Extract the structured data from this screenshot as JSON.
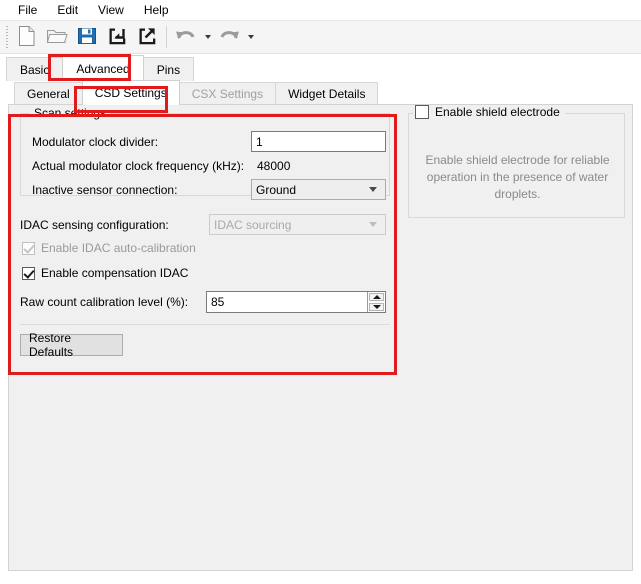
{
  "menu": {
    "items": [
      {
        "label": "File"
      },
      {
        "label": "Edit"
      },
      {
        "label": "View"
      },
      {
        "label": "Help"
      }
    ]
  },
  "toolbar": {
    "buttons": [
      {
        "name": "new-file-icon",
        "tooltip": "New"
      },
      {
        "name": "open-folder-icon",
        "tooltip": "Open"
      },
      {
        "name": "save-icon",
        "tooltip": "Save"
      },
      {
        "name": "import-icon",
        "tooltip": "Import"
      },
      {
        "name": "export-icon",
        "tooltip": "Export"
      },
      {
        "name": "undo-icon",
        "tooltip": "Undo"
      },
      {
        "name": "redo-icon",
        "tooltip": "Redo"
      }
    ]
  },
  "outer_tabs": {
    "items": [
      {
        "label": "Basic",
        "active": false
      },
      {
        "label": "Advanced",
        "active": true
      },
      {
        "label": "Pins",
        "active": false
      }
    ]
  },
  "inner_tabs": {
    "items": [
      {
        "label": "General",
        "active": false,
        "disabled": false
      },
      {
        "label": "CSD Settings",
        "active": true,
        "disabled": false
      },
      {
        "label": "CSX Settings",
        "active": false,
        "disabled": true
      },
      {
        "label": "Widget Details",
        "active": false,
        "disabled": false
      }
    ]
  },
  "scan_settings": {
    "legend": "Scan settings",
    "modulator_clock_divider_label": "Modulator clock divider:",
    "modulator_clock_divider_value": "1",
    "actual_frequency_label": "Actual modulator clock frequency (kHz):",
    "actual_frequency_value": "48000",
    "inactive_sensor_label": "Inactive sensor connection:",
    "inactive_sensor_value": "Ground"
  },
  "idac": {
    "sensing_config_label": "IDAC sensing configuration:",
    "sensing_config_value": "IDAC sourcing",
    "auto_calibration_label": "Enable IDAC auto-calibration",
    "auto_calibration_checked": true,
    "compensation_label": "Enable compensation IDAC",
    "compensation_checked": true,
    "raw_count_label": "Raw count calibration level (%):",
    "raw_count_value": "85"
  },
  "actions": {
    "restore_defaults_label": "Restore Defaults"
  },
  "shield": {
    "checkbox_label": "Enable shield electrode",
    "checked": false,
    "help_text": "Enable shield electrode for reliable operation in the presence of water droplets."
  },
  "colors": {
    "highlight": "#e01b1b",
    "panel_bg": "#f0f0f0",
    "accent_blue": "#1f6fb4",
    "disabled_text": "#9a9a9a"
  }
}
